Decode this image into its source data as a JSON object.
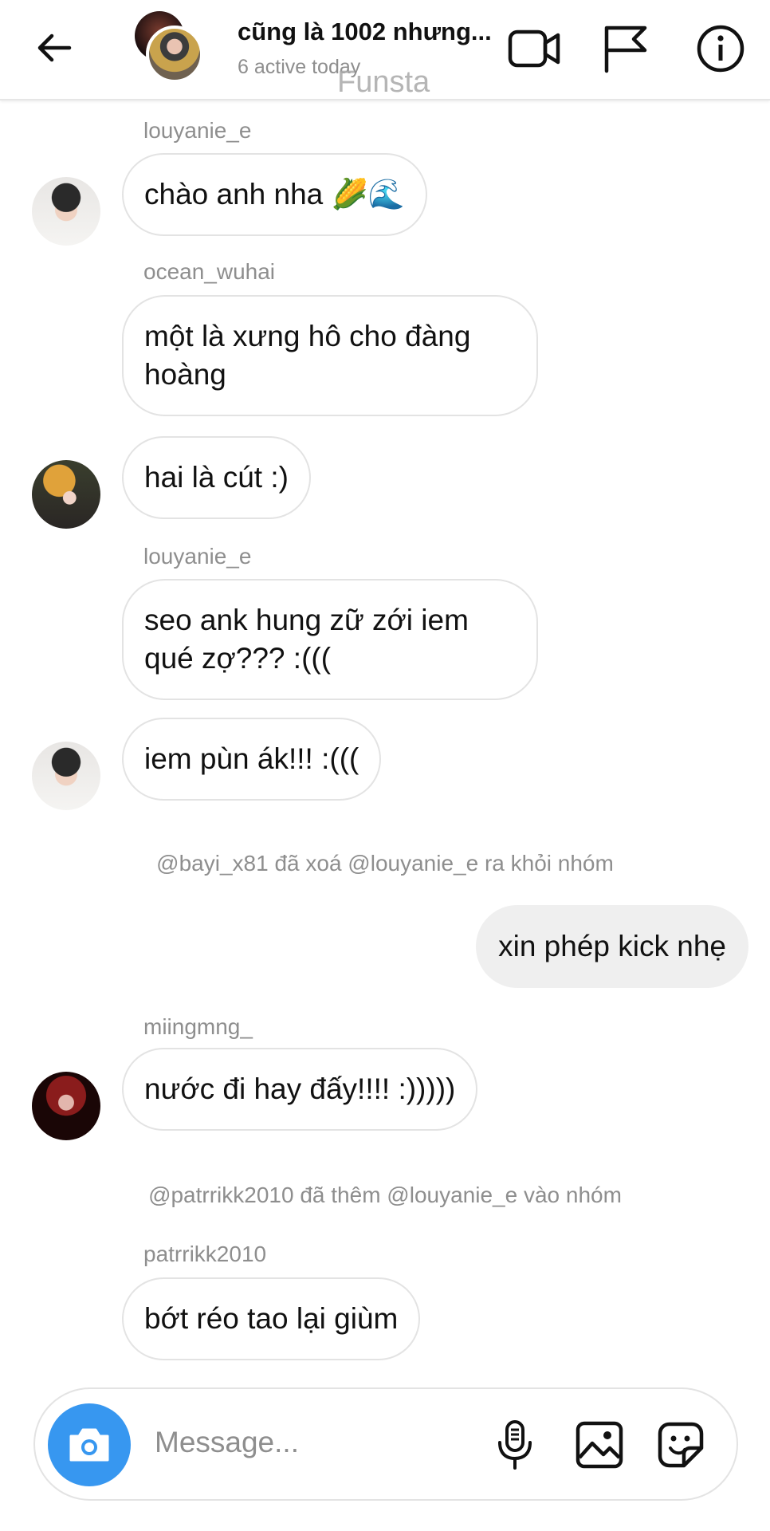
{
  "header": {
    "title": "cũng là 1002 nhưng...",
    "subtitle": "6 active today",
    "watermark": "Funsta"
  },
  "messages": [
    {
      "sender": "louyanie_e",
      "text": "chào anh nha 🌽🌊"
    },
    {
      "sender": "ocean_wuhai",
      "text": "một là xưng hô cho đàng hoàng"
    },
    {
      "sender": "ocean_wuhai",
      "text": "hai là cút :)"
    },
    {
      "sender": "louyanie_e",
      "text": "seo ank hung zữ zới iem qué zợ??? :((("
    },
    {
      "sender": "louyanie_e",
      "text": "iem pùn ák!!! :((("
    },
    {
      "system": "@bayi_x81 đã xoá @louyanie_e ra khỏi nhóm"
    },
    {
      "sender": "me",
      "text": "xin phép kick nhẹ"
    },
    {
      "sender": "miingmng_",
      "text": "nước đi hay đấy!!!! :)))))"
    },
    {
      "system": "@patrrikk2010 đã thêm @louyanie_e vào nhóm"
    },
    {
      "sender": "patrrikk2010",
      "text": "bớt réo tao lại giùm"
    }
  ],
  "sender_labels": {
    "m1": "louyanie_e",
    "m2": "ocean_wuhai",
    "m4": "louyanie_e",
    "m8": "miingmng_",
    "m10": "patrrikk2010"
  },
  "composer": {
    "placeholder": "Message..."
  },
  "icons": {
    "back": "arrow-left-icon",
    "video": "video-camera-icon",
    "report": "flag-icon",
    "info": "info-icon",
    "camera": "camera-icon",
    "mic": "microphone-icon",
    "gallery": "image-icon",
    "sticker": "sticker-icon"
  },
  "colors": {
    "accent": "#3797f0",
    "secondary_text": "#8e8e8e",
    "my_bubble": "#efefef"
  }
}
